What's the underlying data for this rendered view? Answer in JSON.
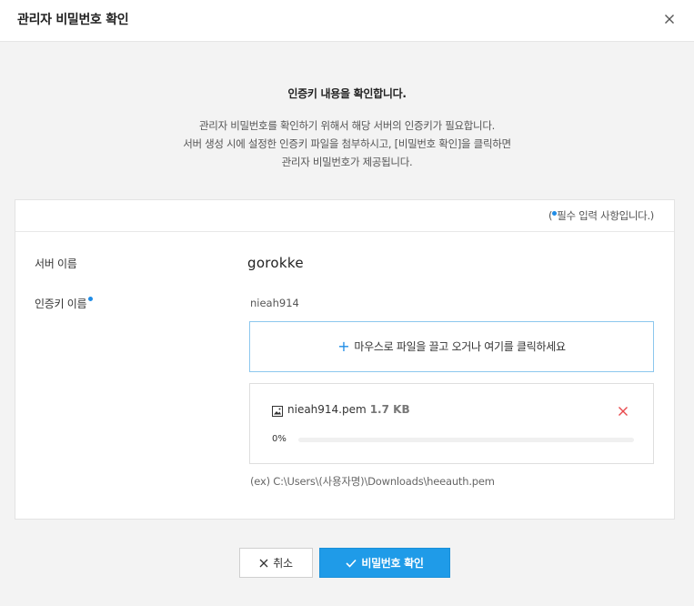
{
  "dialog": {
    "title": "관리자 비밀번호 확인",
    "close_icon": "close-icon"
  },
  "intro": {
    "heading": "인증키 내용을 확인합니다.",
    "lines": [
      "관리자 비밀번호를 확인하기 위해서 해당 서버의 인증키가 필요합니다.",
      "서버 생성 시에 설정한 인증키 파일을 첨부하시고, [비밀번호 확인]을 클릭하면",
      "관리자 비밀번호가 제공됩니다."
    ]
  },
  "form": {
    "required_note_prefix": "(",
    "required_note_text": "필수 입력 사항입니다.)",
    "required_color": "#1f8ce6",
    "server_name_label": "서버 이름",
    "server_name_value": "gorokke",
    "auth_key_label": "인증키 이름",
    "auth_key_value": "nieah914",
    "dropzone_text": "마우스로 파일을 끌고 오거나 여기를 클릭하세요",
    "file": {
      "name": "nieah914.pem",
      "size": "1.7 KB",
      "progress_label": "0%",
      "progress": 0
    },
    "example_path": "(ex) C:\\Users\\(사용자명)\\Downloads\\heeauth.pem"
  },
  "buttons": {
    "cancel": "취소",
    "confirm": "비밀번호 확인"
  }
}
